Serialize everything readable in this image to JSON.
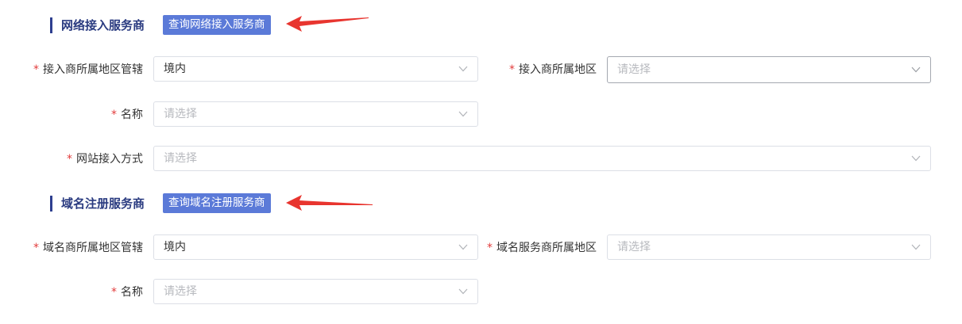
{
  "sections": [
    {
      "title": "网络接入服务商",
      "query_button": "查询网络接入服务商",
      "fields": [
        {
          "label": "接入商所属地区管辖",
          "required": "*",
          "value": "境内",
          "placeholder": ""
        },
        {
          "label": "接入商所属地区",
          "required": "*",
          "value": "",
          "placeholder": "请选择"
        },
        {
          "label": "名称",
          "required": "*",
          "value": "",
          "placeholder": "请选择"
        },
        {
          "label": "网站接入方式",
          "required": "*",
          "value": "",
          "placeholder": "请选择"
        }
      ]
    },
    {
      "title": "域名注册服务商",
      "query_button": "查询域名注册服务商",
      "fields": [
        {
          "label": "域名商所属地区管辖",
          "required": "*",
          "value": "境内",
          "placeholder": ""
        },
        {
          "label": "域名服务商所属地区",
          "required": "*",
          "value": "",
          "placeholder": "请选择"
        },
        {
          "label": "名称",
          "required": "*",
          "value": "",
          "placeholder": "请选择"
        }
      ]
    }
  ],
  "colors": {
    "accent": "#5b7ad8",
    "section_title": "#2a3b80",
    "required": "#e23b3b",
    "annotation_arrow": "#e8352f",
    "placeholder": "#b7b9be"
  },
  "icons": {
    "dropdown": "chevron-down-icon",
    "annotation": "red-arrow-icon"
  }
}
